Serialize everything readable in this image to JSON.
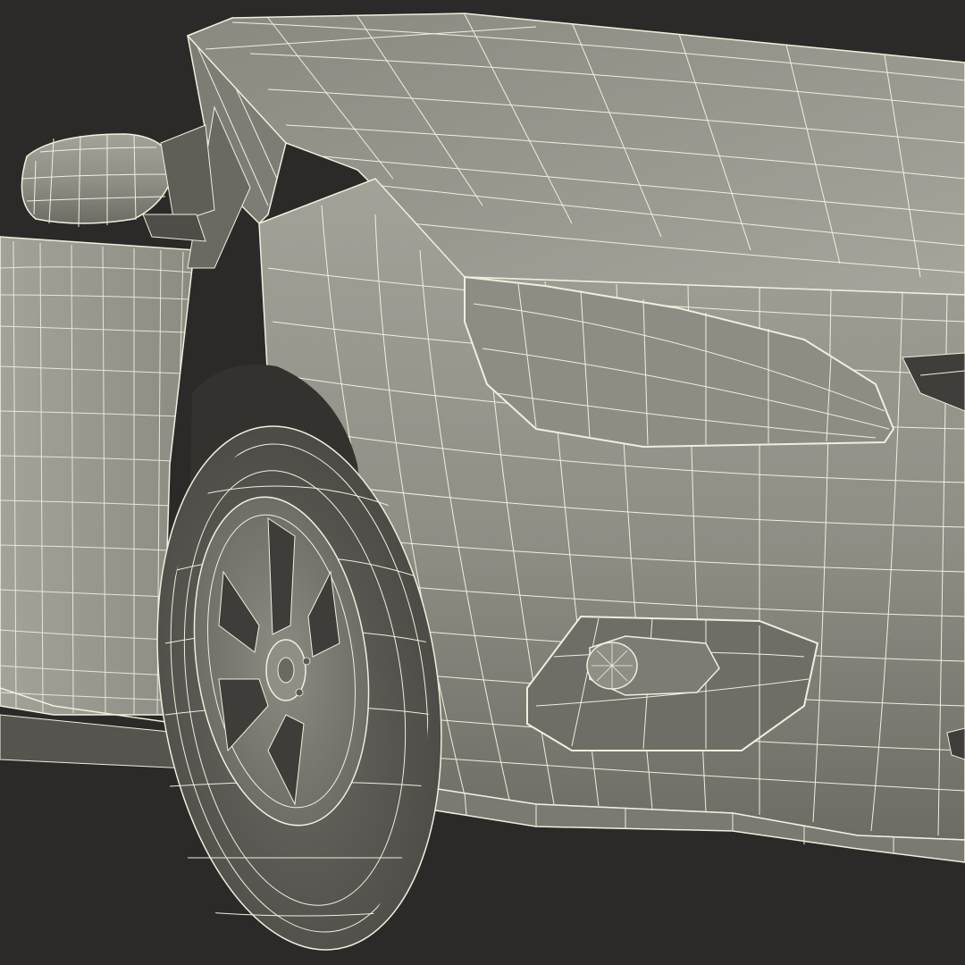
{
  "scene": {
    "subject": "car-front-wireframe-render",
    "colors": {
      "background": "#2b2a29",
      "body_light": "#9e9d94",
      "body_mid": "#85847b",
      "body_dark": "#5f5e57",
      "shadow": "#3a3935",
      "wire": "#f1efdc"
    }
  }
}
